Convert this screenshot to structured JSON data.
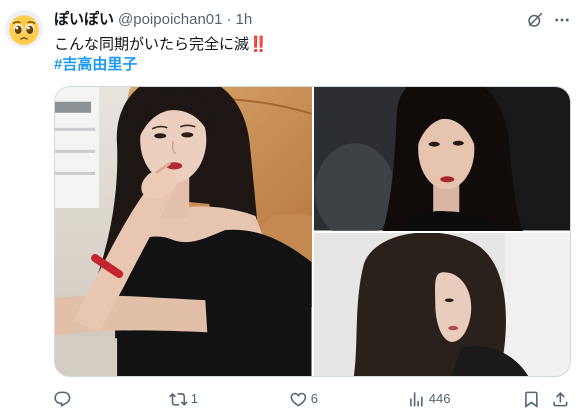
{
  "colors": {
    "text": "#0f1419",
    "secondary": "#536471",
    "link": "#1d9bf0",
    "emoji_red": "#be1931",
    "border": "#cfd9de",
    "background": "#ffffff"
  },
  "tweet": {
    "author": {
      "display_name": "ぽいぽい",
      "handle": "@poipoichan01",
      "avatar_icon": "pleading-face-emoji-icon"
    },
    "separator": "·",
    "time": "1h",
    "header_icons": {
      "grok": "grok-icon",
      "more": "more-icon"
    },
    "text": "こんな同期がいたら完全に滅",
    "text_emoji": "‼️",
    "hashtag": "#吉高由里子",
    "actions": {
      "reply": {
        "icon": "reply-icon"
      },
      "retweet": {
        "icon": "retweet-icon",
        "count": "1"
      },
      "like": {
        "icon": "like-icon",
        "count": "6"
      },
      "views": {
        "icon": "views-icon",
        "count": "446"
      },
      "bookmark": {
        "icon": "bookmark-icon"
      },
      "share": {
        "icon": "share-icon"
      }
    }
  }
}
